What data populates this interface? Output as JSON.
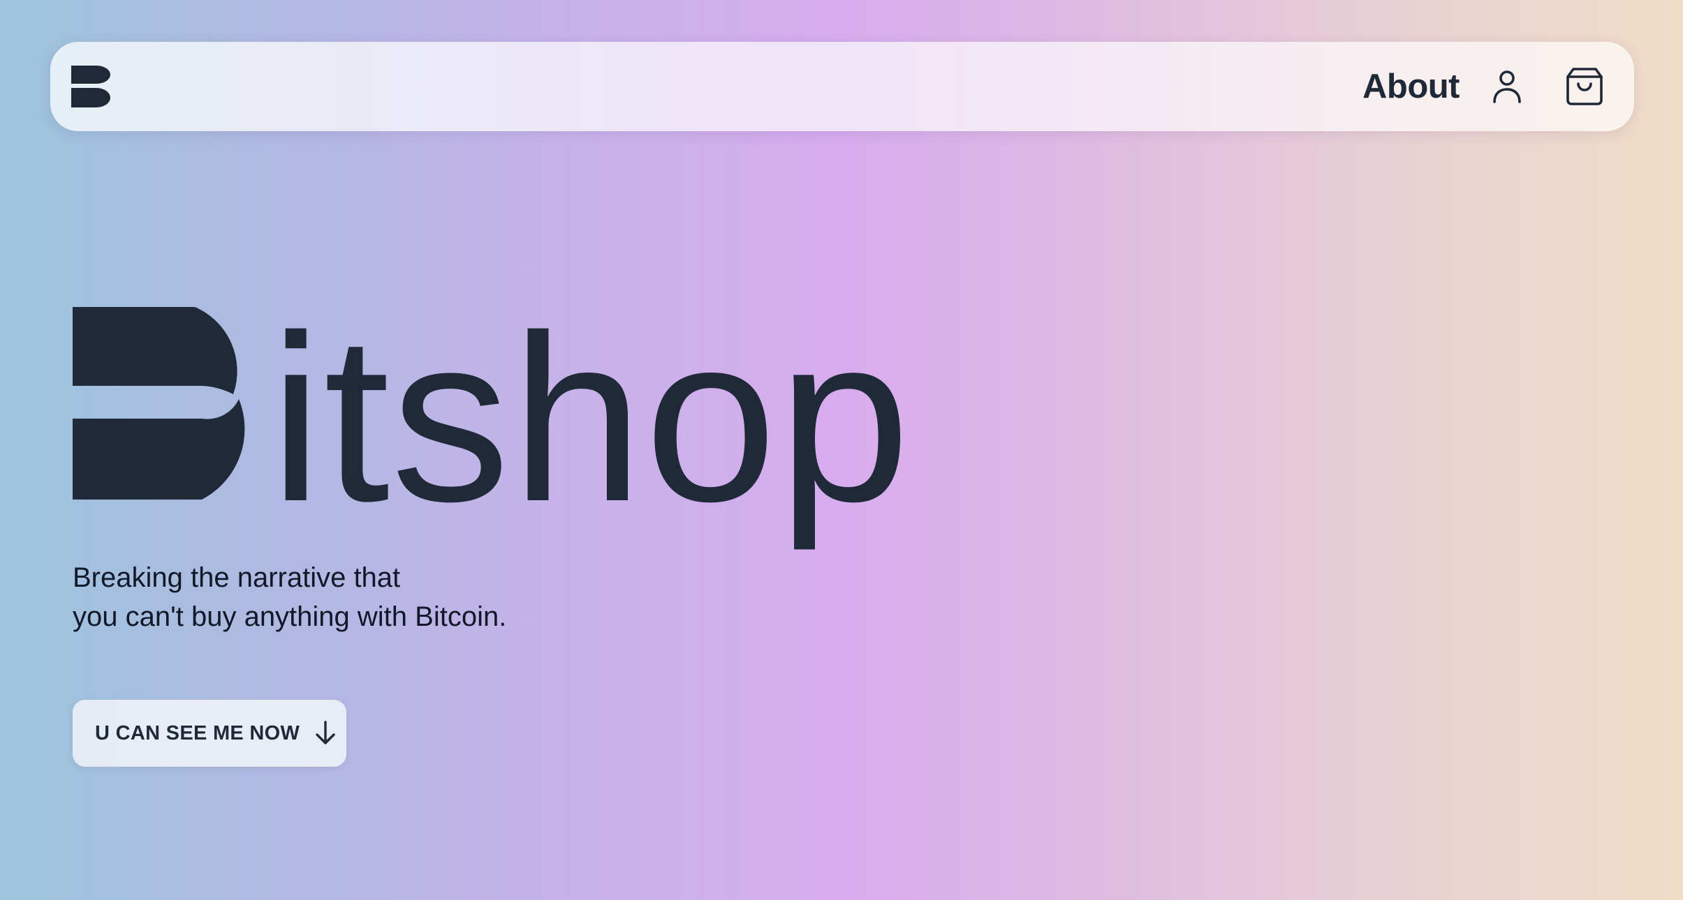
{
  "brand": {
    "name": "Bitshop",
    "wordmark_rest": "itshop",
    "logo_icon": "bitshop-b-logo-icon"
  },
  "navbar": {
    "about_label": "About",
    "user_icon": "user-icon",
    "cart_icon": "shopping-bag-icon"
  },
  "hero": {
    "tagline_line1": "Breaking the narrative that",
    "tagline_line2": "you can't buy anything with Bitcoin.",
    "cta_label": "U CAN SEE ME NOW",
    "cta_icon": "arrow-down-icon"
  },
  "colors": {
    "ink": "#1f2937",
    "gradient_left": "#9cc4dc",
    "gradient_mid": "#d7acee",
    "gradient_right": "#f1dcc6"
  }
}
